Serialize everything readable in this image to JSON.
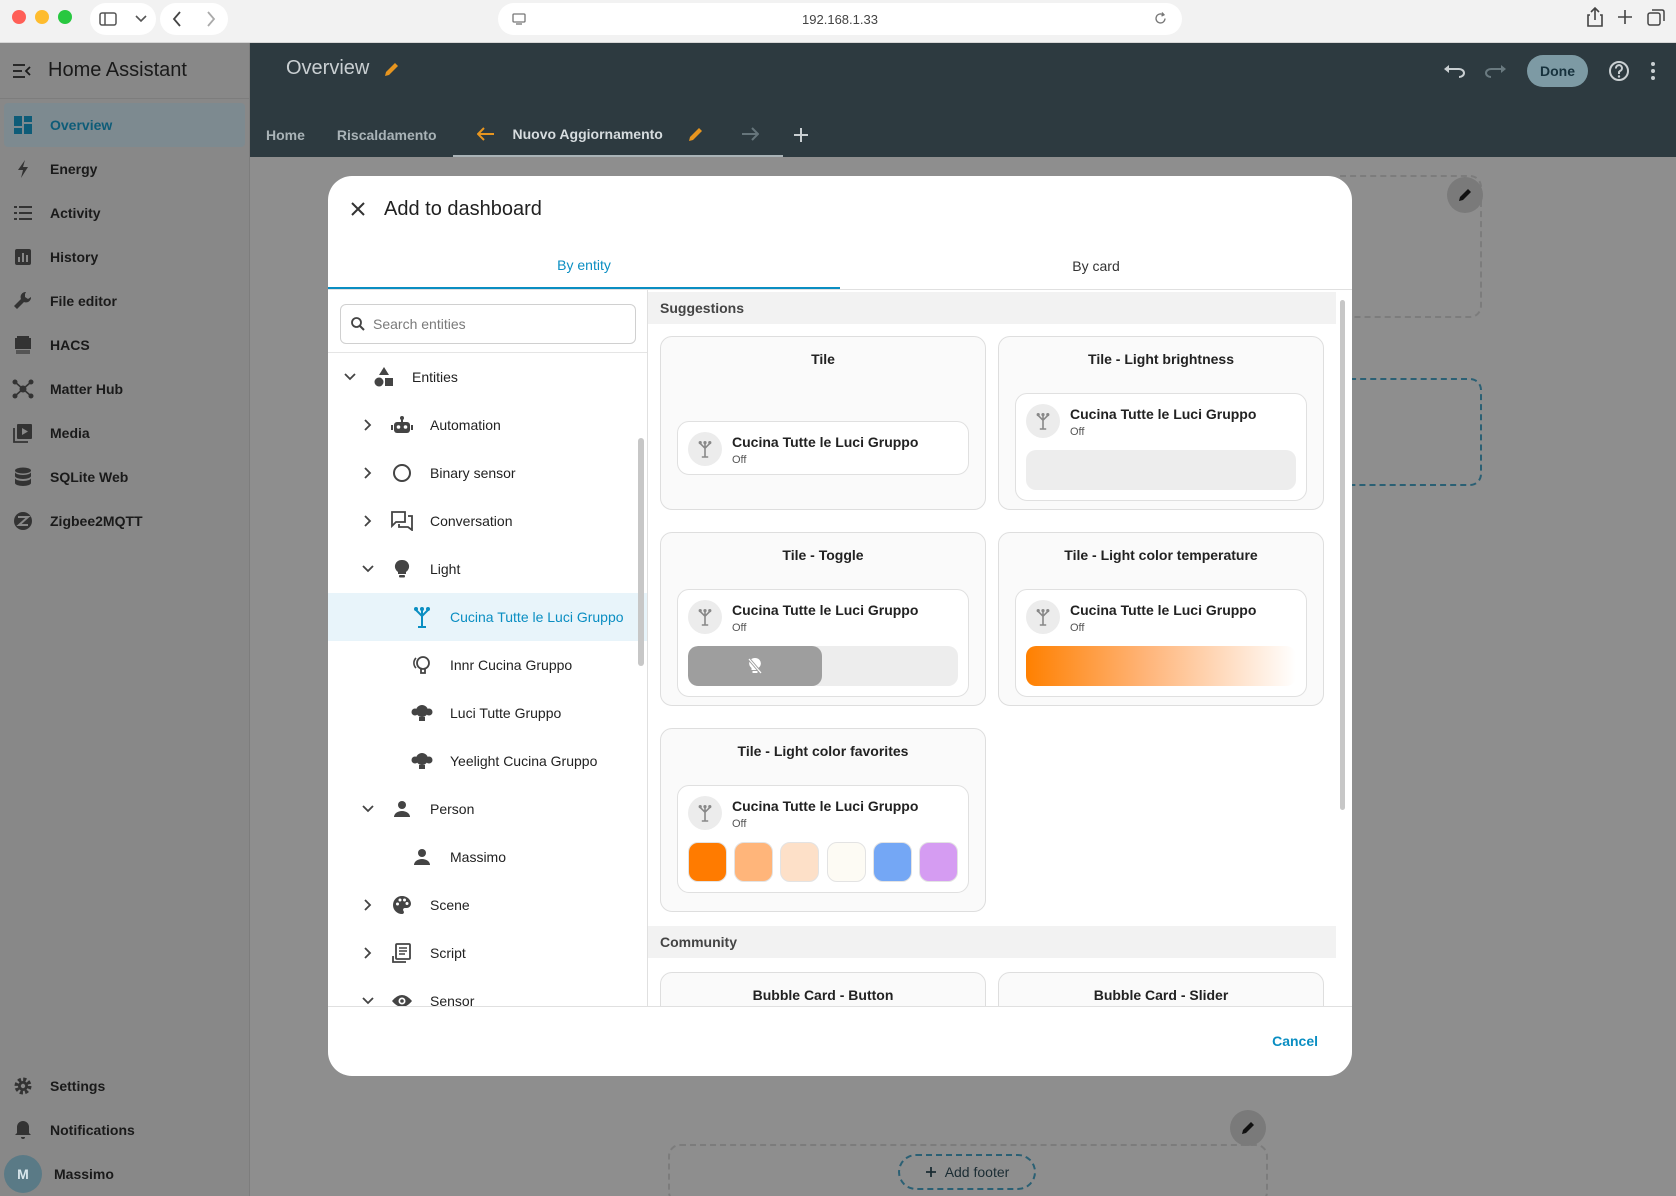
{
  "browser": {
    "url": "192.168.1.33"
  },
  "sidebar": {
    "app_title": "Home Assistant",
    "items": [
      {
        "label": "Overview",
        "icon": "dashboard-icon"
      },
      {
        "label": "Energy",
        "icon": "lightning-icon"
      },
      {
        "label": "Activity",
        "icon": "list-icon"
      },
      {
        "label": "History",
        "icon": "chart-icon"
      },
      {
        "label": "File editor",
        "icon": "wrench-icon"
      },
      {
        "label": "HACS",
        "icon": "hacs-icon"
      },
      {
        "label": "Matter Hub",
        "icon": "hub-icon"
      },
      {
        "label": "Media",
        "icon": "media-icon"
      },
      {
        "label": "SQLite Web",
        "icon": "database-icon"
      },
      {
        "label": "Zigbee2MQTT",
        "icon": "zigbee-icon"
      }
    ],
    "bottom": {
      "settings": "Settings",
      "notifications": "Notifications",
      "user_name": "Massimo",
      "user_initial": "M"
    }
  },
  "header": {
    "title": "Overview",
    "done_label": "Done",
    "tabs": [
      "Home",
      "Riscaldamento",
      "Nuovo Aggiornamento"
    ]
  },
  "background": {
    "add_footer": "Add footer"
  },
  "dialog": {
    "title": "Add to dashboard",
    "tabs": [
      "By entity",
      "By card"
    ],
    "search_placeholder": "Search entities",
    "cancel_label": "Cancel",
    "tree": {
      "root": "Entities",
      "automation": "Automation",
      "binary_sensor": "Binary sensor",
      "conversation": "Conversation",
      "light": "Light",
      "light_entities": [
        "Cucina Tutte le Luci Gruppo",
        "Innr Cucina Gruppo",
        "Luci Tutte Gruppo",
        "Yeelight Cucina Gruppo"
      ],
      "person": "Person",
      "person_entities": [
        "Massimo"
      ],
      "scene": "Scene",
      "script": "Script",
      "sensor": "Sensor"
    },
    "suggestions_label": "Suggestions",
    "community_label": "Community",
    "entity_name": "Cucina Tutte le Luci Gruppo",
    "entity_state": "Off",
    "cards": {
      "tile": "Tile",
      "brightness": "Tile - Light brightness",
      "toggle": "Tile - Toggle",
      "color_temp": "Tile - Light color temperature",
      "favorites": "Tile - Light color favorites",
      "bubble_button": "Bubble Card - Button",
      "bubble_slider": "Bubble Card - Slider"
    },
    "favorite_colors": [
      "#ff7b00",
      "#ffb57a",
      "#fde0c8",
      "#fdfbf4",
      "#74a7f5",
      "#d59cf2"
    ]
  },
  "colors": {
    "accent": "#0a8ec2",
    "header_bg": "#2d3a40"
  }
}
